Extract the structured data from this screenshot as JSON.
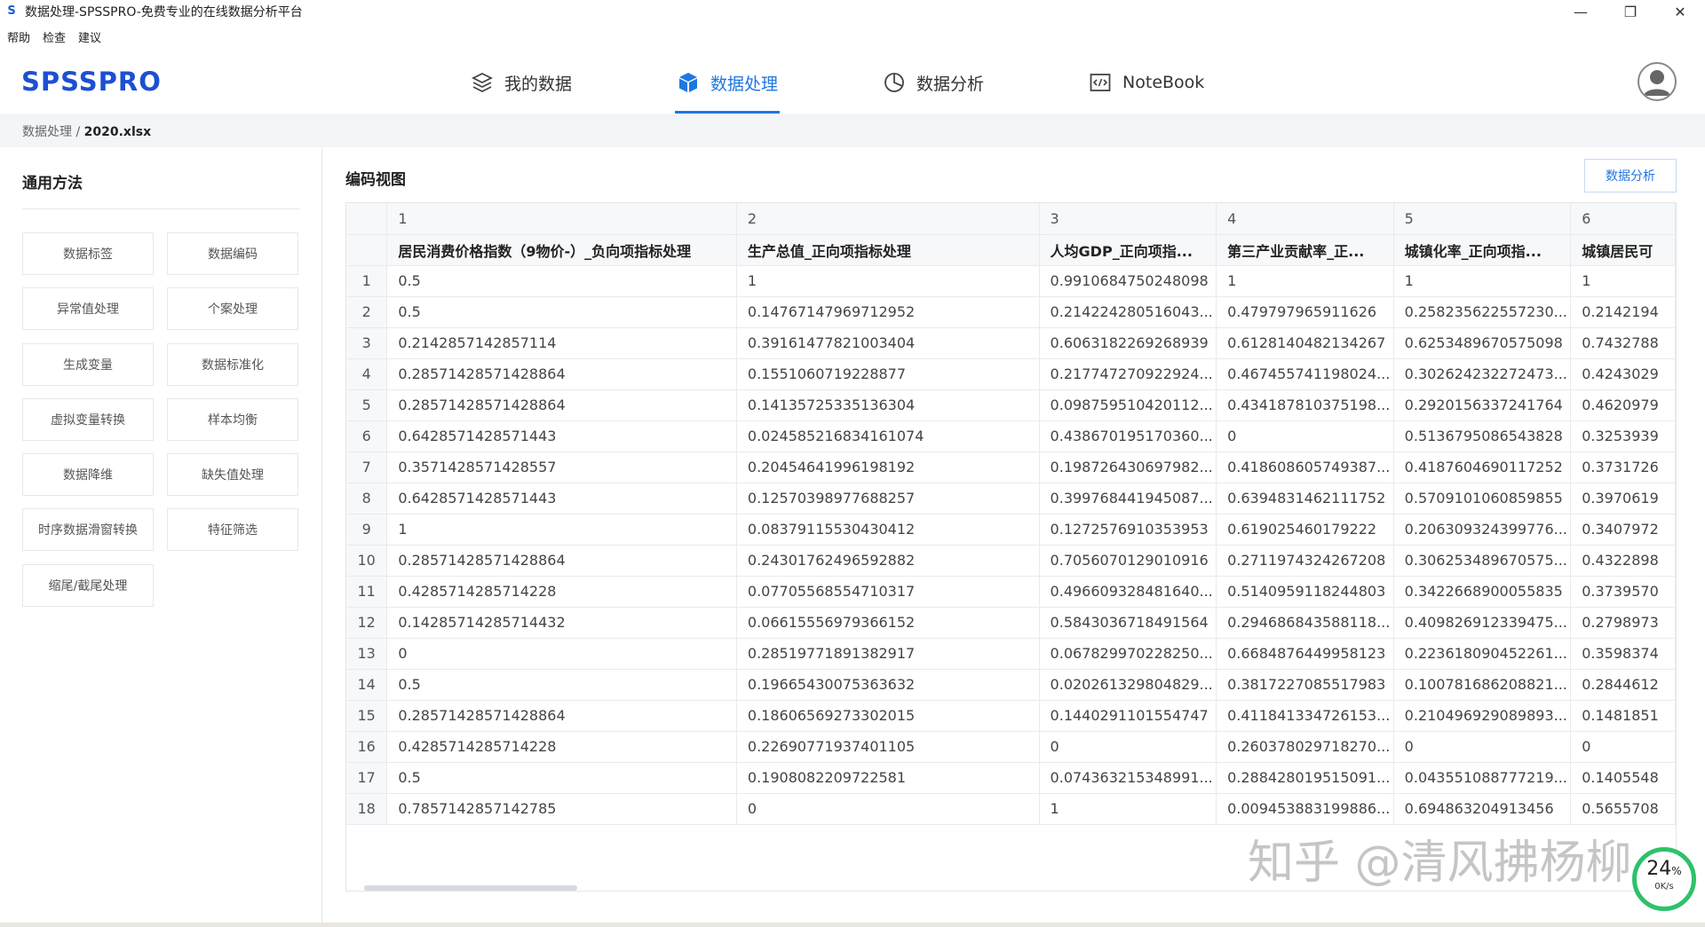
{
  "window": {
    "title": "数据处理-SPSSPRO-免费专业的在线数据分析平台",
    "logo_glyph": "S",
    "controls": {
      "minimize": "—",
      "restore": "❐",
      "close": "✕"
    }
  },
  "menubar": {
    "items": [
      "帮助",
      "检查",
      "建议"
    ]
  },
  "brand": {
    "name": "SPSSPRO",
    "color": "#1c4fd2"
  },
  "nav": {
    "items": [
      {
        "label": "我的数据",
        "icon": "layers-icon",
        "active": false
      },
      {
        "label": "数据处理",
        "icon": "cube-icon",
        "active": true
      },
      {
        "label": "数据分析",
        "icon": "pie-chart-icon",
        "active": false
      },
      {
        "label": "NoteBook",
        "icon": "code-icon",
        "active": false
      }
    ],
    "active_color": "#1f77e0"
  },
  "breadcrumb": {
    "parent": "数据处理",
    "separator": "/",
    "current": "2020.xlsx"
  },
  "sidebar": {
    "title": "通用方法",
    "buttons": [
      "数据标签",
      "数据编码",
      "异常值处理",
      "个案处理",
      "生成变量",
      "数据标准化",
      "虚拟变量转换",
      "样本均衡",
      "数据降维",
      "缺失值处理",
      "时序数据滑窗转换",
      "特征筛选",
      "缩尾/截尾处理"
    ]
  },
  "main": {
    "title": "编码视图",
    "analyze_button": "数据分析",
    "table": {
      "column_numbers": [
        "1",
        "2",
        "3",
        "4",
        "5",
        "6"
      ],
      "headers": [
        "居民消费价格指数（9物价-）_负向项指标处理",
        "生产总值_正向项指标处理",
        "人均GDP_正向项指...",
        "第三产业贡献率_正...",
        "城镇化率_正向项指...",
        "城镇居民可"
      ],
      "rows": [
        [
          "1",
          "0.5",
          "1",
          "0.9910684750248098",
          "1",
          "1",
          "1"
        ],
        [
          "2",
          "0.5",
          "0.14767147969712952",
          "0.214224280516043...",
          "0.479797965911626",
          "0.258235622557230...",
          "0.2142194"
        ],
        [
          "3",
          "0.2142857142857114",
          "0.39161477821003404",
          "0.6063182269268939",
          "0.6128140482134267",
          "0.6253489670575098",
          "0.7432788"
        ],
        [
          "4",
          "0.28571428571428864",
          "0.1551060719228877",
          "0.217747270922924...",
          "0.467455741198024...",
          "0.302624232272473...",
          "0.4243029"
        ],
        [
          "5",
          "0.28571428571428864",
          "0.14135725335136304",
          "0.098759510420112...",
          "0.434187810375198...",
          "0.2920156337241764",
          "0.4620979"
        ],
        [
          "6",
          "0.6428571428571443",
          "0.024585216834161074",
          "0.438670195170360...",
          "0",
          "0.5136795086543828",
          "0.3253939"
        ],
        [
          "7",
          "0.3571428571428557",
          "0.20454641996198192",
          "0.198726430697982...",
          "0.418608605749387...",
          "0.4187604690117252",
          "0.3731726"
        ],
        [
          "8",
          "0.6428571428571443",
          "0.12570398977688257",
          "0.399768441945087...",
          "0.6394831462111752",
          "0.5709101060859855",
          "0.3970619"
        ],
        [
          "9",
          "1",
          "0.08379115530430412",
          "0.1272576910353953",
          "0.619025460179222",
          "0.206309324399776...",
          "0.3407972"
        ],
        [
          "10",
          "0.28571428571428864",
          "0.24301762496592882",
          "0.7056070129010916",
          "0.2711974324267208",
          "0.306253489670575...",
          "0.4322898"
        ],
        [
          "11",
          "0.4285714285714228",
          "0.07705568554710317",
          "0.496609328481640...",
          "0.5140959118244803",
          "0.3422668900055835",
          "0.3739570"
        ],
        [
          "12",
          "0.14285714285714432",
          "0.06615556979366152",
          "0.5843036718491564",
          "0.294686843588118...",
          "0.409826912339475...",
          "0.2798973"
        ],
        [
          "13",
          "0",
          "0.28519771891382917",
          "0.067829970228250...",
          "0.6684876449958123",
          "0.223618090452261...",
          "0.3598374"
        ],
        [
          "14",
          "0.5",
          "0.19665430075363632",
          "0.020261329804829...",
          "0.3817227085517983",
          "0.100781686208821...",
          "0.2844612"
        ],
        [
          "15",
          "0.28571428571428864",
          "0.18606569273302015",
          "0.1440291101554747",
          "0.411841334726153...",
          "0.210496929089893...",
          "0.1481851"
        ],
        [
          "16",
          "0.4285714285714228",
          "0.22690771937401105",
          "0",
          "0.260378029718270...",
          "0",
          "0"
        ],
        [
          "17",
          "0.5",
          "0.1908082209722581",
          "0.074363215348991...",
          "0.288428019515091...",
          "0.043551088777219...",
          "0.1405548"
        ],
        [
          "18",
          "0.7857142857142785",
          "0",
          "1",
          "0.009453883199886...",
          "0.694863204913456",
          "0.5655708"
        ]
      ]
    }
  },
  "watermark": "知乎 @清风拂杨柳",
  "speed_badge": {
    "percent": "24",
    "percent_sign": "%",
    "rate": "0K/s"
  }
}
